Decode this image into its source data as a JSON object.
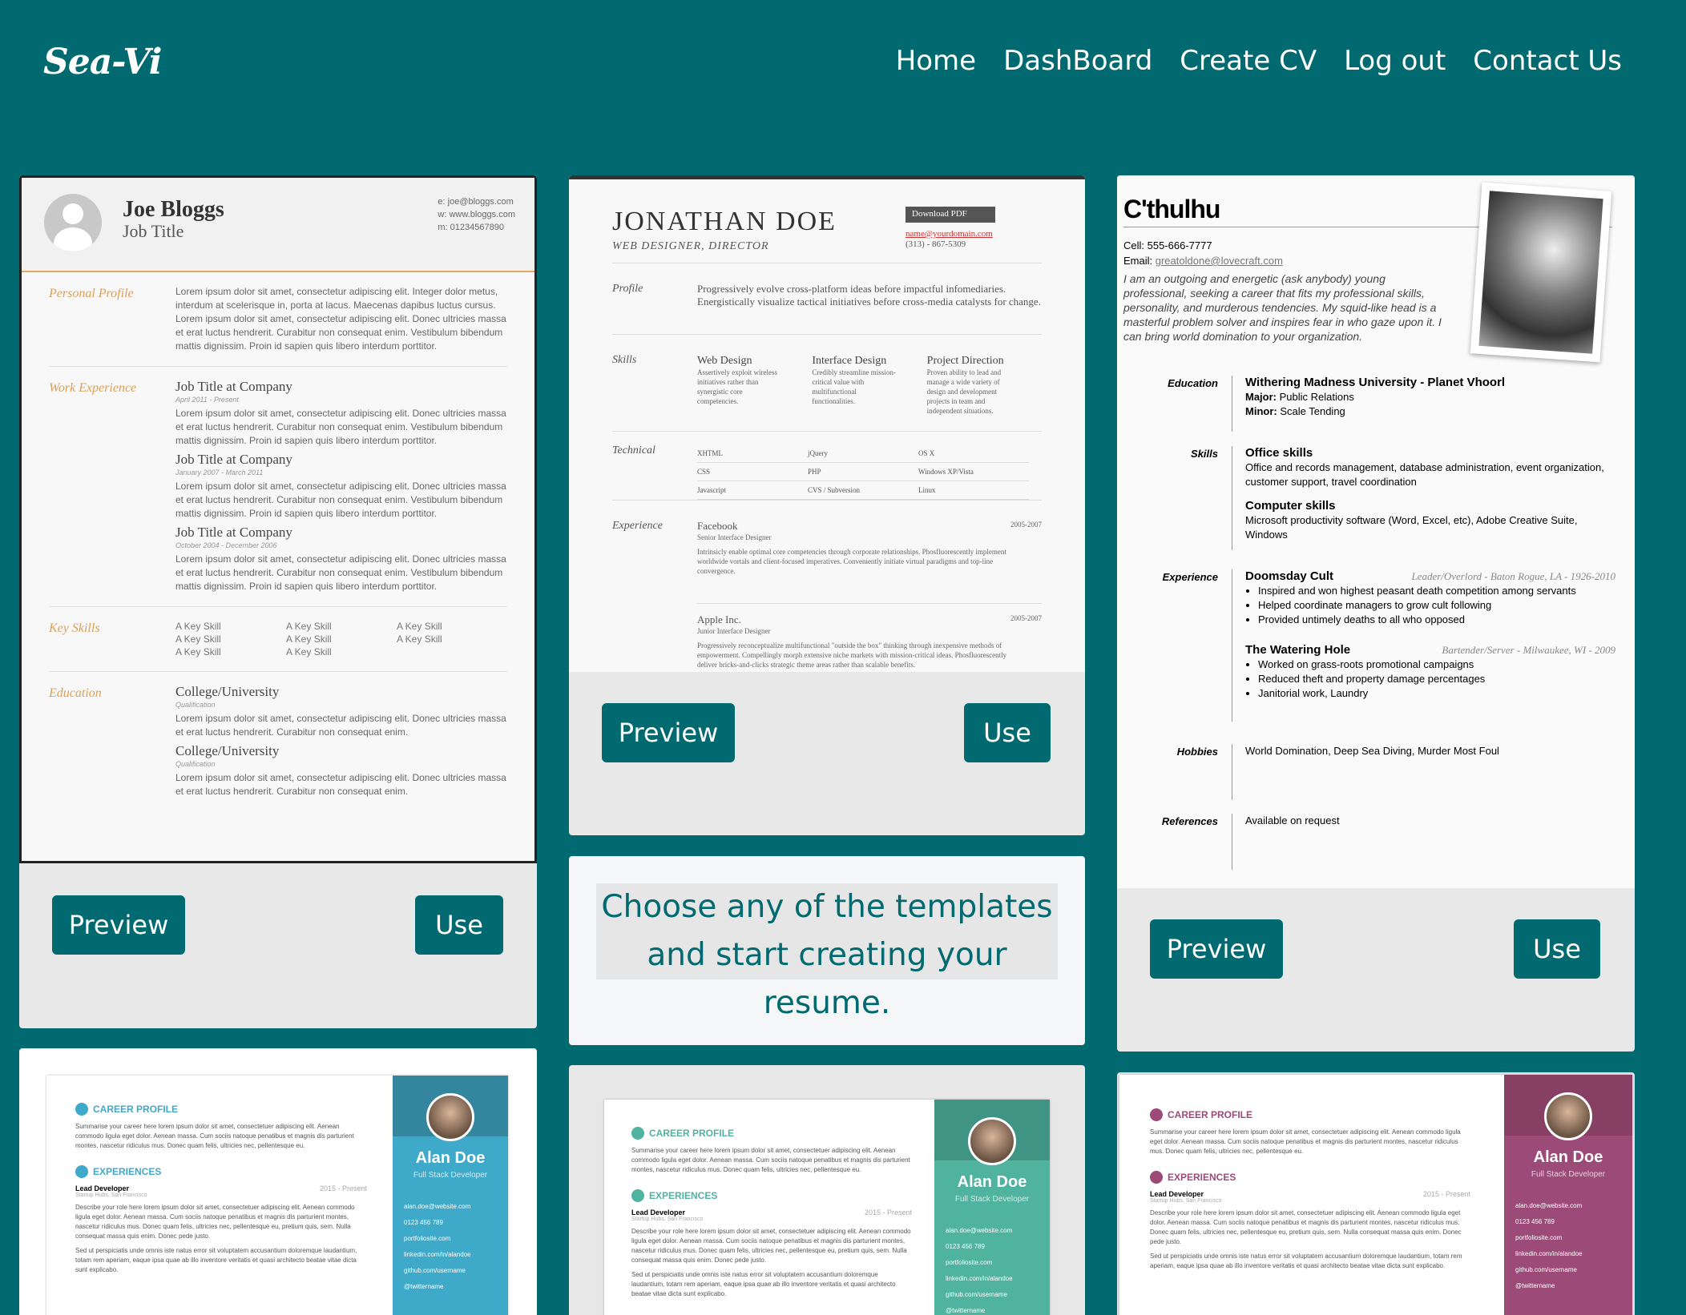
{
  "header": {
    "logo": "Sea-Vi",
    "nav": [
      "Home",
      "DashBoard",
      "Create CV",
      "Log out",
      "Contact Us"
    ]
  },
  "buttons": {
    "preview": "Preview",
    "use": "Use"
  },
  "info_text": "Choose any of the templates and start creating your resume.",
  "resume1": {
    "name": "Joe Bloggs",
    "job_title": "Job Title",
    "contact": [
      "e: joe@bloggs.com",
      "w: www.bloggs.com",
      "m: 01234567890"
    ],
    "profile_label": "Personal Profile",
    "profile_text": "Lorem ipsum dolor sit amet, consectetur adipiscing elit. Integer dolor metus, interdum at scelerisque in, porta at lacus. Maecenas dapibus luctus cursus. Lorem ipsum dolor sit amet, consectetur adipiscing elit. Donec ultricies massa et erat luctus hendrerit. Curabitur non consequat enim. Vestibulum bibendum mattis dignissim. Proin id sapien quis libero interdum porttitor.",
    "work_label": "Work Experience",
    "jobs": [
      {
        "title": "Job Title at Company",
        "dates": "April 2011 - Present",
        "text": "Lorem ipsum dolor sit amet, consectetur adipiscing elit. Donec ultricies massa et erat luctus hendrerit. Curabitur non consequat enim. Vestibulum bibendum mattis dignissim. Proin id sapien quis libero interdum porttitor."
      },
      {
        "title": "Job Title at Company",
        "dates": "January 2007 - March 2011",
        "text": "Lorem ipsum dolor sit amet, consectetur adipiscing elit. Donec ultricies massa et erat luctus hendrerit. Curabitur non consequat enim. Vestibulum bibendum mattis dignissim. Proin id sapien quis libero interdum porttitor."
      },
      {
        "title": "Job Title at Company",
        "dates": "October 2004 - December 2006",
        "text": "Lorem ipsum dolor sit amet, consectetur adipiscing elit. Donec ultricies massa et erat luctus hendrerit. Curabitur non consequat enim. Vestibulum bibendum mattis dignissim. Proin id sapien quis libero interdum porttitor."
      }
    ],
    "skills_label": "Key Skills",
    "skill": "A Key Skill",
    "education_label": "Education",
    "education": [
      {
        "title": "College/University",
        "qual": "Qualification",
        "text": "Lorem ipsum dolor sit amet, consectetur adipiscing elit. Donec ultricies massa et erat luctus hendrerit. Curabitur non consequat enim."
      },
      {
        "title": "College/University",
        "qual": "Qualification",
        "text": "Lorem ipsum dolor sit amet, consectetur adipiscing elit. Donec ultricies massa et erat luctus hendrerit. Curabitur non consequat enim."
      }
    ]
  },
  "resume2": {
    "name": "JONATHAN DOE",
    "role": "WEB DESIGNER, DIRECTOR",
    "download": "Download PDF",
    "email": "name@yourdomain.com",
    "phone": "(313) - 867-5309",
    "profile_label": "Profile",
    "profile_text": "Progressively evolve cross-platform ideas before impactful infomediaries. Energistically visualize tactical initiatives before cross-media catalysts for change.",
    "skills_label": "Skills",
    "skills": [
      {
        "name": "Web Design",
        "text": "Assertively exploit wireless initiatives rather than synergistic core competencies."
      },
      {
        "name": "Interface Design",
        "text": "Credibly streamline mission-critical value with multifunctional functionalities."
      },
      {
        "name": "Project Direction",
        "text": "Proven ability to lead and manage a wide variety of design and development projects in team and independent situations."
      }
    ],
    "technical_label": "Technical",
    "technical": [
      "XHTML",
      "jQuery",
      "OS X",
      "CSS",
      "PHP",
      "Windows XP/Vista",
      "Javascript",
      "CVS / Subversion",
      "Linux"
    ],
    "experience_label": "Experience",
    "experience": [
      {
        "company": "Facebook",
        "title": "Senior Interface Designer",
        "years": "2005-2007",
        "text": "Intrinsicly enable optimal core competencies through corporate relationships. Phosfluorescently implement worldwide vortals and client-focused imperatives. Conveniently initiate virtual paradigms and top-line convergence."
      },
      {
        "company": "Apple Inc.",
        "title": "Junior Interface Designer",
        "years": "2005-2007",
        "text": "Progressively reconceptualize multifunctional \"outside the box\" thinking through inexpensive methods of empowerment. Compellingly morph extensive niche markets with mission-critical ideas. Phosfluorescently deliver bricks-and-clicks strategic theme areas rather than scalable benefits."
      }
    ]
  },
  "resume3": {
    "name": "C'thulhu",
    "cell": "Cell: 555-666-7777",
    "email_label": "Email:",
    "email": "greatoldone@lovecraft.com",
    "intro": "I am an outgoing and energetic (ask anybody) young professional, seeking a career that fits my professional skills, personality, and murderous tendencies. My squid-like head is a masterful problem solver and inspires fear in who gaze upon it. I can bring world domination to your organization.",
    "education_label": "Education",
    "university": "Withering Madness University - Planet Vhoorl",
    "major_label": "Major:",
    "major": "Public Relations",
    "minor_label": "Minor:",
    "minor": "Scale Tending",
    "skills_label": "Skills",
    "skills": [
      {
        "name": "Office skills",
        "text": "Office and records management, database administration, event organization, customer support, travel coordination"
      },
      {
        "name": "Computer skills",
        "text": "Microsoft productivity software (Word, Excel, etc), Adobe Creative Suite, Windows"
      }
    ],
    "experience_label": "Experience",
    "jobs": [
      {
        "name": "Doomsday Cult",
        "loc": "Leader/Overlord - Baton Rogue, LA - 1926-2010",
        "items": [
          "Inspired and won highest peasant death competition among servants",
          "Helped coordinate managers to grow cult following",
          "Provided untimely deaths to all who opposed"
        ]
      },
      {
        "name": "The Watering Hole",
        "loc": "Bartender/Server - Milwaukee, WI - 2009",
        "items": [
          "Worked on grass-roots promotional campaigns",
          "Reduced theft and property damage percentages",
          "Janitorial work, Laundry"
        ]
      }
    ],
    "hobbies_label": "Hobbies",
    "hobbies": "World Domination, Deep Sea Diving, Murder Most Foul",
    "references_label": "References",
    "references": "Available on request"
  },
  "bottom_resume": {
    "name": "Alan Doe",
    "title": "Full Stack Developer",
    "career_heading": "CAREER PROFILE",
    "career_text": "Summarise your career here lorem ipsum dolor sit amet, consectetuer adipiscing elit. Aenean commodo ligula eget dolor. Aenean massa. Cum sociis natoque penatibus et magnis dis parturient montes, nascetur ridiculus mus. Donec quam felis, ultricies nec, pellentesque eu.",
    "exp_heading": "EXPERIENCES",
    "role": "Lead Developer",
    "period": "2015 - Present",
    "company": "Startup Hubs, San Francisco",
    "desc": "Describe your role here lorem ipsum dolor sit amet, consectetuer adipiscing elit. Aenean commodo ligula eget dolor. Aenean massa. Cum sociis natoque penatibus et magnis dis parturient montes, nascetur ridiculus mus. Donec quam felis, ultricies nec, pellentesque eu, pretium quis, sem. Nulla consequat massa quis enim. Donec pede justo.",
    "desc2": "Sed ut perspiciatis unde omnis iste natus error sit voluptatem accusantium doloremque laudantium, totam rem aperiam, eaque ipsa quae ab illo inventore veritatis et quasi architecto beatae vitae dicta sunt explicabo.",
    "links": [
      "alan.doe@website.com",
      "0123 456 789",
      "portfoliosite.com",
      "linkedin.com/in/alandoe",
      "github.com/username",
      "@twittername"
    ]
  },
  "colors": {
    "background": "#016a70",
    "button": "#016a70",
    "blue_sidebar": "#3fa9c9",
    "green_sidebar": "#4fb3a0",
    "purple_sidebar": "#9c4a78"
  }
}
